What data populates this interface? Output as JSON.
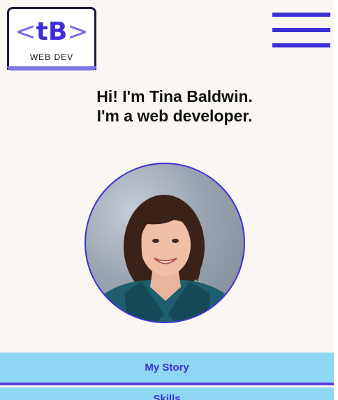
{
  "logo": {
    "open_angle": "<",
    "mark": "tB",
    "close_angle": ">",
    "subtitle": "WEB DEV"
  },
  "intro": {
    "line1": "Hi! I'm Tina Baldwin.",
    "line2": "I'm a web developer."
  },
  "nav": {
    "items": [
      {
        "label": "My Story"
      },
      {
        "label": "Skills"
      }
    ]
  },
  "colors": {
    "accent": "#3d2fd6",
    "nav_bg": "#8fd8f3",
    "page_bg": "#faf6f2"
  }
}
